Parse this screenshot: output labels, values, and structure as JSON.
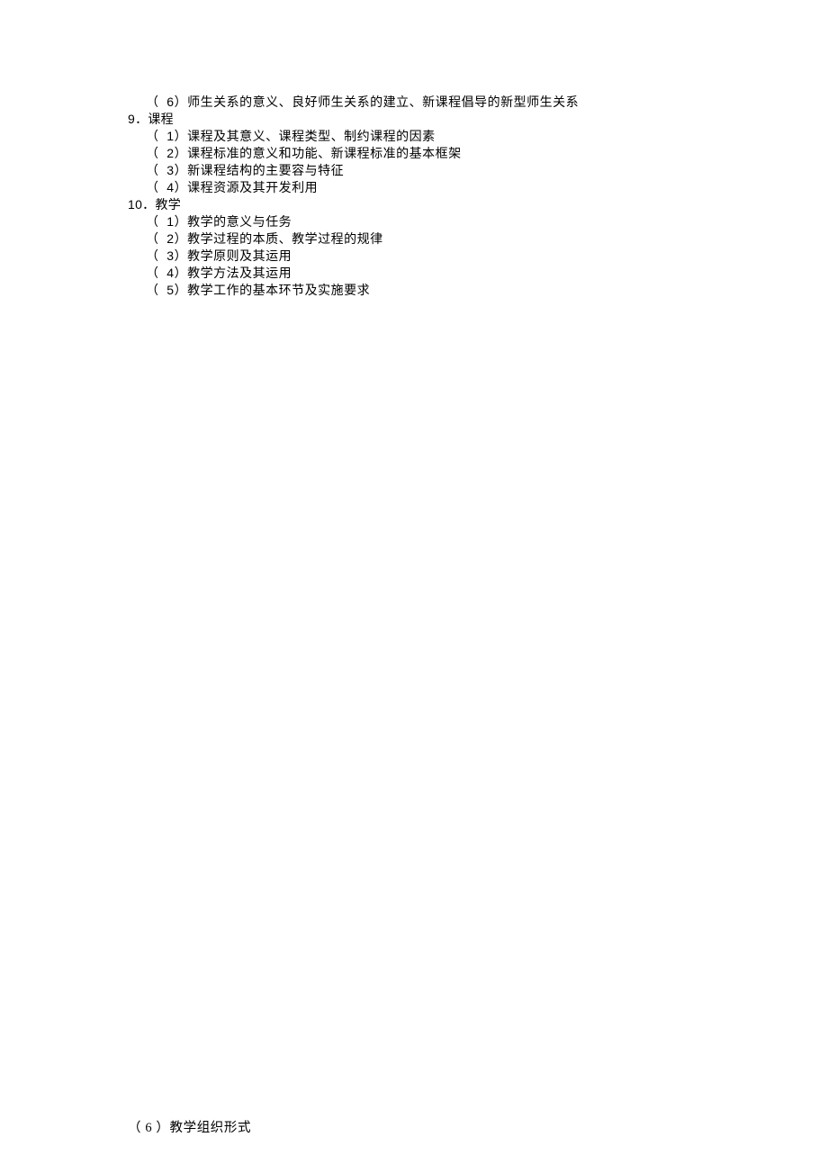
{
  "top": {
    "line1": "（  6）师生关系的意义、良好师生关系的建立、新课程倡导的新型师生关系",
    "head9": "9．课程",
    "line9_1": "（  1）课程及其意义、课程类型、制约课程的因素",
    "line9_2": "（  2）课程标准的意义和功能、新课程标准的基本框架",
    "line9_3": "（  3）新课程结构的主要容与特征",
    "line9_4": "（  4）课程资源及其开发利用",
    "head10": "10．教学",
    "line10_1": "（  1）教学的意义与任务",
    "line10_2": "（  2）教学过程的本质、教学过程的规律",
    "line10_3": "（  3）教学原则及其运用",
    "line10_4": "（  4）教学方法及其运用",
    "line10_5": "（  5）教学工作的基本环节及实施要求"
  },
  "bottom": {
    "line": "（ 6 ）教学组织形式"
  }
}
